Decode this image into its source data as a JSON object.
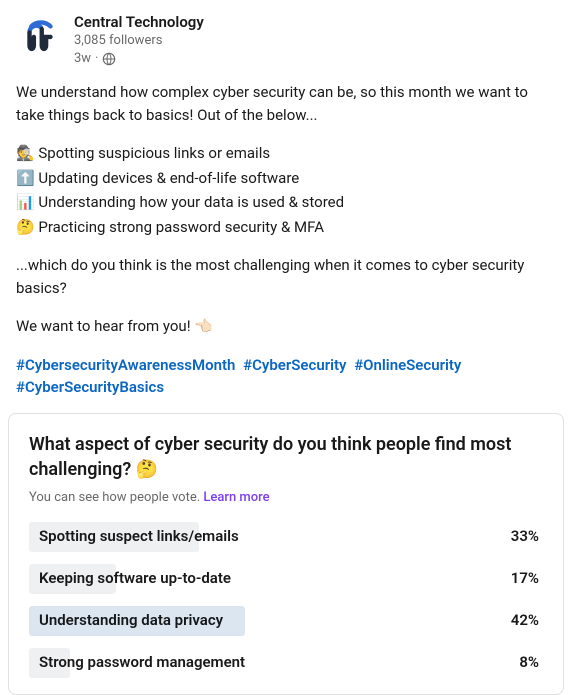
{
  "header": {
    "author_name": "Central Technology",
    "followers": "3,085 followers",
    "timestamp": "3w",
    "separator": " · ",
    "visibility_icon": "globe-icon"
  },
  "body": {
    "intro": "We understand how complex cyber security can be, so this month we want to take things back to basics! Out of the below...",
    "bullets": [
      "🕵️ Spotting suspicious links or emails",
      "⬆️ Updating devices & end-of-life software",
      "📊 Understanding how your data is used & stored",
      "🤔 Practicing strong password security & MFA"
    ],
    "outro": "...which do you think is the most challenging when it comes to cyber security basics?",
    "cta": "We want to hear from you! 👈🏻",
    "hashtags": [
      "#CybersecurityAwarenessMonth",
      "#CyberSecurity",
      "#OnlineSecurity",
      "#CyberSecurityBasics"
    ]
  },
  "poll": {
    "question": "What aspect of cyber security do you think people find most challenging? 🤔",
    "subtext": "You can see how people vote. ",
    "learn_more": "Learn more",
    "options": [
      {
        "label": "Spotting suspect links/emails",
        "percent": 33,
        "percent_text": "33%",
        "winner": false
      },
      {
        "label": "Keeping software up-to-date",
        "percent": 17,
        "percent_text": "17%",
        "winner": false
      },
      {
        "label": "Understanding data privacy",
        "percent": 42,
        "percent_text": "42%",
        "winner": true
      },
      {
        "label": "Strong password management",
        "percent": 8,
        "percent_text": "8%",
        "winner": false
      }
    ]
  }
}
